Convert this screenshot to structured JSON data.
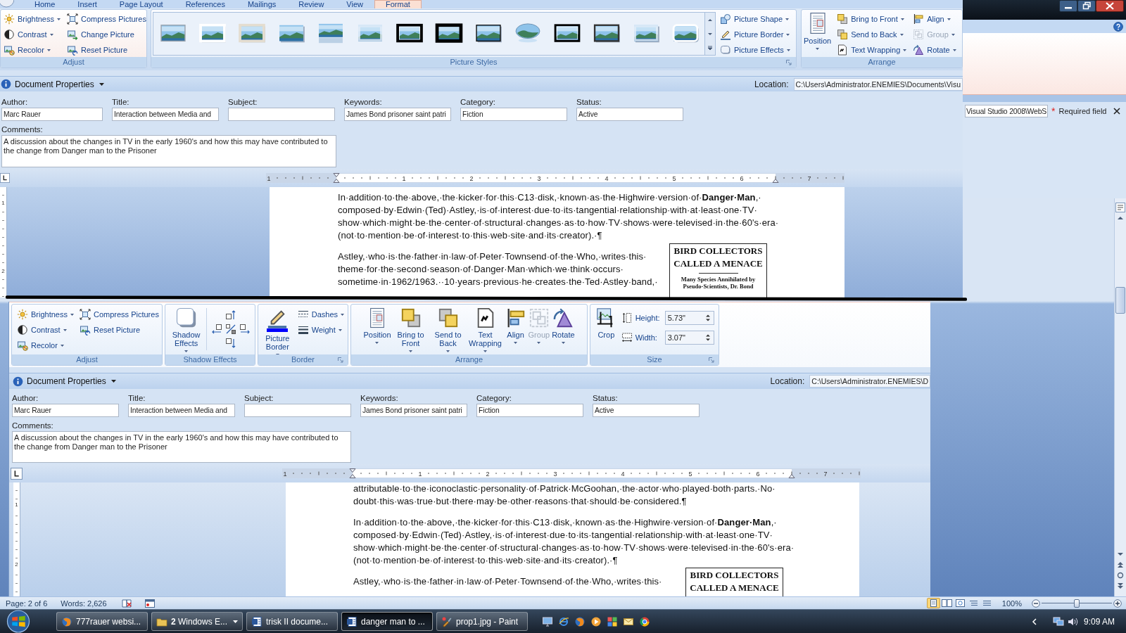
{
  "windows": [
    {
      "tabs": [
        {
          "label": "Home",
          "selected": false
        },
        {
          "label": "Insert",
          "selected": false
        },
        {
          "label": "Page Layout",
          "selected": false
        },
        {
          "label": "References",
          "selected": false
        },
        {
          "label": "Mailings",
          "selected": false
        },
        {
          "label": "Review",
          "selected": false
        },
        {
          "label": "View",
          "selected": false
        },
        {
          "label": "Format",
          "selected": true
        }
      ],
      "ribbon": [
        {
          "label": "Adjust",
          "launcher": false,
          "columns": [
            {
              "kind": "stack",
              "items": [
                {
                  "kind": "brightness",
                  "label": "Brightness",
                  "dropdown": true,
                  "disabled": false
                },
                {
                  "kind": "contrast",
                  "label": "Contrast",
                  "dropdown": true,
                  "disabled": false
                },
                {
                  "kind": "recolor",
                  "label": "Recolor",
                  "dropdown": true,
                  "disabled": false
                }
              ]
            },
            {
              "kind": "stack",
              "items": [
                {
                  "kind": "compress",
                  "label": "Compress Pictures",
                  "dropdown": false,
                  "disabled": false
                },
                {
                  "kind": "change-picture",
                  "label": "Change Picture",
                  "dropdown": false,
                  "disabled": false
                },
                {
                  "kind": "reset",
                  "label": "Reset Picture",
                  "dropdown": false,
                  "disabled": false
                }
              ]
            }
          ]
        },
        {
          "label": "Picture Styles",
          "launcher": true,
          "columns": [
            {
              "kind": "gallery",
              "styles": [
                {
                  "kind": "thin-frame"
                },
                {
                  "kind": "white-frame"
                },
                {
                  "kind": "matte-frame"
                },
                {
                  "kind": "drop-shadow"
                },
                {
                  "kind": "reflection"
                },
                {
                  "kind": "soft-edges"
                },
                {
                  "kind": "double-black"
                },
                {
                  "kind": "thick-black"
                },
                {
                  "kind": "dark-shadow"
                },
                {
                  "kind": "oval"
                },
                {
                  "kind": "black-inner"
                },
                {
                  "kind": "dark-frame"
                },
                {
                  "kind": "soft-shadow"
                },
                {
                  "kind": "rounded-white"
                }
              ]
            },
            {
              "kind": "stack",
              "items": [
                {
                  "kind": "picture-shape",
                  "label": "Picture Shape",
                  "dropdown": true,
                  "disabled": false
                },
                {
                  "kind": "picture-border",
                  "label": "Picture Border",
                  "dropdown": true,
                  "disabled": false
                },
                {
                  "kind": "picture-effects",
                  "label": "Picture Effects",
                  "dropdown": true,
                  "disabled": false
                }
              ]
            }
          ]
        },
        {
          "label": "Arrange",
          "launcher": false,
          "columns": [
            {
              "kind": "large",
              "items": [
                {
                  "kind": "position",
                  "label": "Position",
                  "dropdown": true,
                  "disabled": false
                }
              ]
            },
            {
              "kind": "stack",
              "items": [
                {
                  "kind": "bring-front",
                  "label": "Bring to Front",
                  "dropdown": true,
                  "disabled": false
                },
                {
                  "kind": "send-back",
                  "label": "Send to Back",
                  "dropdown": true,
                  "disabled": false
                },
                {
                  "kind": "text-wrapping",
                  "label": "Text Wrapping",
                  "dropdown": true,
                  "disabled": false
                }
              ]
            },
            {
              "kind": "stack",
              "items": [
                {
                  "kind": "align",
                  "label": "Align",
                  "dropdown": true,
                  "disabled": false
                },
                {
                  "kind": "group",
                  "label": "Group",
                  "dropdown": true,
                  "disabled": true
                },
                {
                  "kind": "rotate",
                  "label": "Rotate",
                  "dropdown": true,
                  "disabled": false
                }
              ]
            }
          ]
        }
      ],
      "document_properties": {
        "title": "Document Properties",
        "location_label": "Location:",
        "location": "C:\\Users\\Administrator.ENEMIES\\Documents\\Visu",
        "fields": [
          {
            "label": "Author:",
            "value": "Marc Rauer"
          },
          {
            "label": "Title:",
            "value": "Interaction between Media and"
          },
          {
            "label": "Subject:"
          },
          {
            "label": "Keywords:",
            "value": "James Bond prisoner saint patri"
          },
          {
            "label": "Category:",
            "value": "Fiction"
          },
          {
            "label": "Status:",
            "value": "Active"
          }
        ],
        "comments": {
          "label": "Comments:",
          "value": "A discussion about the changes in TV in the early 1960's and how this may have contributed to the change from Danger man to the Prisoner"
        }
      },
      "ruler": [
        "1",
        "1",
        "2",
        "3",
        "4",
        "5",
        "6",
        "7"
      ],
      "vertical_ruler": [
        "1",
        "2"
      ],
      "page": {
        "paragraphs": [
          {
            "lines": [
              "In·addition·to·the·above,·the·kicker·for·this·C13·disk,·known·as·the·Highwire·version·of·**Danger·Man**,·",
              "composed·by·Edwin·(Ted)·Astley,·is·of·interest·due·to·its·tangential·relationship·with·at·least·one·TV·",
              "show·which·might·be·the·center·of·structural·changes·as·to·how·TV·shows·were·televised·in·the·60's·era·",
              "(not·to·mention·be·of·interest·to·this·web·site·and·its·creator).·¶"
            ]
          },
          {
            "lines": [
              "Astley,·who·is·the·father·in·law·of·Peter·Townsend·of·the·Who,·writes·this·",
              "theme·for·the·second·season·of·Danger·Man·which·we·think·occurs·",
              "sometime·in·1962/1963.··10·years·previous·he·creates·the·Ted·Astley·band,·"
            ]
          }
        ],
        "clipping": {
          "headline": [
            "BIRD COLLECTORS",
            "CALLED A MENACE"
          ],
          "subhead": [
            "Many Species Annihilated by",
            "Pseudo-Scientists, Dr. Bond"
          ]
        }
      }
    },
    {
      "ribbon": [
        {
          "label": "Adjust",
          "launcher": false,
          "columns": [
            {
              "kind": "stack",
              "items": [
                {
                  "kind": "brightness",
                  "label": "Brightness",
                  "dropdown": true,
                  "disabled": false
                },
                {
                  "kind": "contrast",
                  "label": "Contrast",
                  "dropdown": true,
                  "disabled": false
                },
                {
                  "kind": "recolor",
                  "label": "Recolor",
                  "dropdown": true,
                  "disabled": false
                }
              ]
            },
            {
              "kind": "stack",
              "items": [
                {
                  "kind": "compress",
                  "label": "Compress Pictures",
                  "dropdown": false,
                  "disabled": false
                },
                {
                  "kind": "reset",
                  "label": "Reset Picture",
                  "dropdown": false,
                  "disabled": false
                }
              ]
            }
          ]
        },
        {
          "label": "Shadow Effects",
          "launcher": false,
          "columns": [
            {
              "kind": "large",
              "items": [
                {
                  "kind": "shadow-effects",
                  "label": "Shadow Effects",
                  "dropdown": true,
                  "disabled": false
                }
              ]
            },
            {
              "kind": "nudge",
              "items": [
                {
                  "kind": "nudge-up",
                  "disabled": false
                },
                {
                  "kind": "nudge-left",
                  "disabled": false
                },
                {
                  "kind": "shadow-toggle",
                  "disabled": false
                },
                {
                  "kind": "nudge-right",
                  "disabled": false
                },
                {
                  "kind": "nudge-down",
                  "disabled": false
                }
              ]
            }
          ]
        },
        {
          "label": "Border",
          "launcher": true,
          "columns": [
            {
              "kind": "large",
              "items": [
                {
                  "kind": "picture-border",
                  "label": "Picture Border",
                  "dropdown": true,
                  "disabled": false,
                  "color": "#0000ff"
                }
              ]
            },
            {
              "kind": "stack",
              "items": [
                {
                  "kind": "dashes",
                  "label": "Dashes",
                  "dropdown": true,
                  "disabled": false
                },
                {
                  "kind": "weight",
                  "label": "Weight",
                  "dropdown": true,
                  "disabled": false
                }
              ]
            }
          ]
        },
        {
          "label": "Arrange",
          "launcher": false,
          "columns": [
            {
              "kind": "large",
              "items": [
                {
                  "kind": "position",
                  "label": "Position",
                  "dropdown": true,
                  "disabled": false
                },
                {
                  "kind": "bring-front",
                  "label": "Bring to Front",
                  "dropdown": true,
                  "disabled": false
                },
                {
                  "kind": "send-back",
                  "label": "Send to Back",
                  "dropdown": true,
                  "disabled": false
                },
                {
                  "kind": "text-wrapping",
                  "label": "Text Wrapping",
                  "dropdown": true,
                  "disabled": false
                },
                {
                  "kind": "align",
                  "label": "Align",
                  "dropdown": true,
                  "disabled": false
                },
                {
                  "kind": "group",
                  "label": "Group",
                  "dropdown": true,
                  "disabled": true
                },
                {
                  "kind": "rotate",
                  "label": "Rotate",
                  "dropdown": true,
                  "disabled": false
                }
              ]
            }
          ]
        },
        {
          "label": "Size",
          "launcher": true,
          "columns": [
            {
              "kind": "large",
              "items": [
                {
                  "kind": "crop",
                  "label": "Crop",
                  "dropdown": false,
                  "disabled": false
                }
              ]
            },
            {
              "kind": "spinners",
              "items": [
                {
                  "kind": "height",
                  "label": "Height:",
                  "value": "5.73\""
                },
                {
                  "kind": "width",
                  "label": "Width:",
                  "value": "3.07\""
                }
              ]
            }
          ]
        }
      ],
      "document_properties": {
        "title": "Document Properties",
        "location_label": "Location:",
        "location": "C:\\Users\\Administrator.ENEMIES\\D",
        "fields": [
          {
            "label": "Author:",
            "value": "Marc Rauer"
          },
          {
            "label": "Title:",
            "value": "Interaction between Media and"
          },
          {
            "label": "Subject:"
          },
          {
            "label": "Keywords:",
            "value": "James Bond prisoner saint patri"
          },
          {
            "label": "Category:",
            "value": "Fiction"
          },
          {
            "label": "Status:",
            "value": "Active"
          }
        ],
        "comments": {
          "label": "Comments:",
          "value": "A discussion about the changes in TV in the early 1960's and how this may have contributed to the change from Danger man to the Prisoner"
        }
      },
      "ruler": [
        "1",
        "1",
        "2",
        "3",
        "4",
        "5",
        "6",
        "7"
      ],
      "vertical_ruler": [
        "1",
        "2"
      ],
      "page": {
        "paragraphs": [
          {
            "lines": [
              "attributable·to·the·iconoclastic·personality·of·Patrick·McGoohan,·the·actor·who·played·both·parts.·No·",
              "doubt·this·was·true·but·there·may·be·other·reasons·that·should·be·considered.¶"
            ]
          },
          {
            "lines": [
              "In·addition·to·the·above,·the·kicker·for·this·C13·disk,·known·as·the·Highwire·version·of·**Danger·Man**,·",
              "composed·by·Edwin·(Ted)·Astley,·is·of·interest·due·to·its·tangential·relationship·with·at·least·one·TV·",
              "show·which·might·be·the·center·of·structural·changes·as·to·how·TV·shows·were·televised·in·the·60's·era·",
              "(not·to·mention·be·of·interest·to·this·web·site·and·its·creator).·¶"
            ]
          },
          {
            "lines": [
              "Astley,·who·is·the·father·in·law·of·Peter·Townsend·of·the·Who,·writes·this·"
            ]
          }
        ],
        "clipping": {
          "headline": [
            "BIRD COLLECTORS",
            "CALLED A MENACE"
          ]
        }
      }
    }
  ],
  "back_window": {
    "window_controls": [
      {
        "kind": "minimize"
      },
      {
        "kind": "restore"
      },
      {
        "kind": "close"
      }
    ],
    "info_bar": {
      "location": "Visual Studio 2008\\WebS",
      "required_mark": "*",
      "required_label": "Required field"
    }
  },
  "status_bar": {
    "page": "Page: 2 of 6",
    "words": "Words: 2,626",
    "views": [
      {
        "kind": "print",
        "selected": true
      },
      {
        "kind": "reading",
        "selected": false
      },
      {
        "kind": "web",
        "selected": false
      },
      {
        "kind": "outline",
        "selected": false
      },
      {
        "kind": "draft",
        "selected": false
      }
    ],
    "zoom": "100%",
    "zoom_slider": {
      "level": 0.5
    }
  },
  "taskbar": {
    "buttons": [
      {
        "kind": "globe",
        "label": "777rauer websi...",
        "selected": false,
        "dropdown": false
      },
      {
        "kind": "folder",
        "label": "**2** Windows E...",
        "selected": false,
        "dropdown": true
      },
      {
        "kind": "document",
        "label": "trisk II docume...",
        "selected": false,
        "dropdown": false
      },
      {
        "kind": "document",
        "label": "danger man to ...",
        "selected": true,
        "dropdown": false
      },
      {
        "kind": "paintbrush",
        "label": "prop1.jpg - Paint",
        "selected": false,
        "dropdown": false
      }
    ],
    "quick_launch": [
      {
        "kind": "monitor"
      },
      {
        "kind": "ring"
      },
      {
        "kind": "globe"
      },
      {
        "kind": "play"
      },
      {
        "kind": "panes"
      },
      {
        "kind": "mail"
      },
      {
        "kind": "wheel"
      }
    ],
    "clock": "9:09 AM"
  }
}
